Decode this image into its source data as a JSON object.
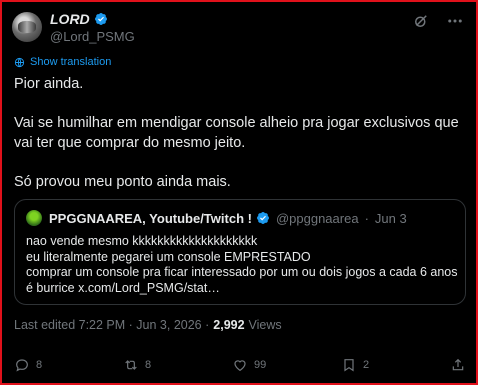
{
  "author": {
    "name": "LORD",
    "handle": "@Lord_PSMG",
    "verified_color": "#1d9bf0"
  },
  "top_icons": [
    "grok-icon",
    "more-icon"
  ],
  "translation": {
    "label": "Show translation",
    "icon": "globe-icon"
  },
  "tweet": {
    "paragraphs": [
      "Pior ainda.",
      "Vai se humilhar em mendigar console alheio pra jogar exclusivos que vai ter que comprar do mesmo jeito.",
      "Só provou meu ponto ainda mais."
    ]
  },
  "quote": {
    "name": "PPGGNAAREA, Youtube/Twitch !",
    "handle": "@ppggnaarea",
    "separator": "·",
    "date": "Jun 3",
    "lines": [
      "nao vende mesmo kkkkkkkkkkkkkkkkkkkk",
      "eu literalmente pegarei um console EMPRESTADO",
      "comprar um console pra ficar interessado por um ou dois jogos a cada 6 anos",
      "é burrice x.com/Lord_PSMG/stat…"
    ]
  },
  "meta": {
    "edited": "Last edited 7:22 PM · Jun 3, 2026 ·",
    "views_count": "2,992",
    "views_label": "Views"
  },
  "actions": {
    "replies": "8",
    "reposts": "8",
    "likes": "99",
    "bookmarks": "2"
  },
  "colors": {
    "background": "#000000",
    "accent": "#1d9bf0",
    "muted": "#71767b",
    "border": "#2f3336",
    "frame": "#e0111b"
  }
}
